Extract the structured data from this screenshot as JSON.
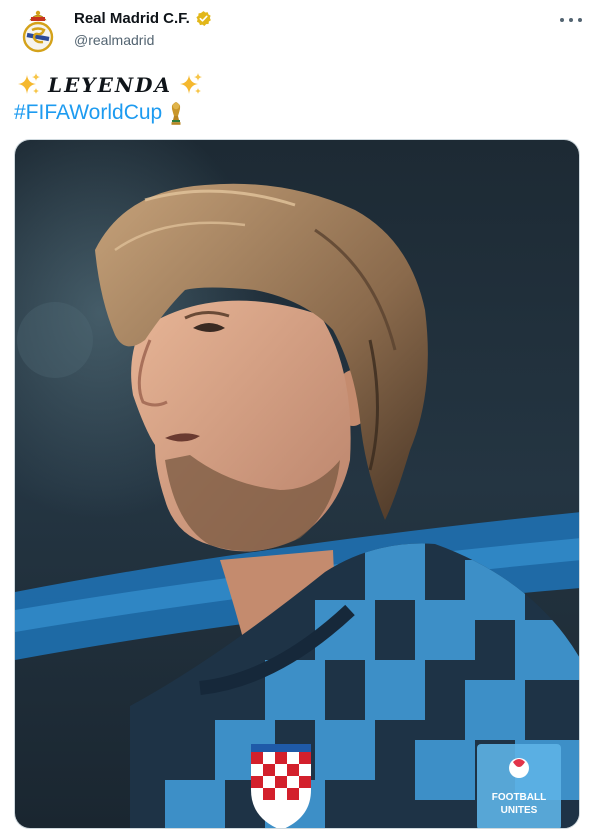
{
  "account": {
    "display_name": "Real Madrid C.F.",
    "handle": "@realmadrid",
    "verified": true,
    "avatar_icon": "real-madrid-crest-icon",
    "verified_icon": "gold-verified-badge-icon"
  },
  "menu": {
    "icon": "more-options-icon"
  },
  "tweet": {
    "title_text": "LEYENDA",
    "title_icons": [
      "sparkles-icon",
      "sparkles-icon"
    ],
    "hashtag": "#FIFAWorldCup",
    "hashtag_icon": "world-cup-trophy-icon"
  },
  "media": {
    "badge_text_line1": "FOOTBALL",
    "badge_text_line2": "UNITES"
  },
  "colors": {
    "link": "#1d9bf0",
    "secondary_text": "#536471",
    "verified_gold": "#e2b719"
  }
}
